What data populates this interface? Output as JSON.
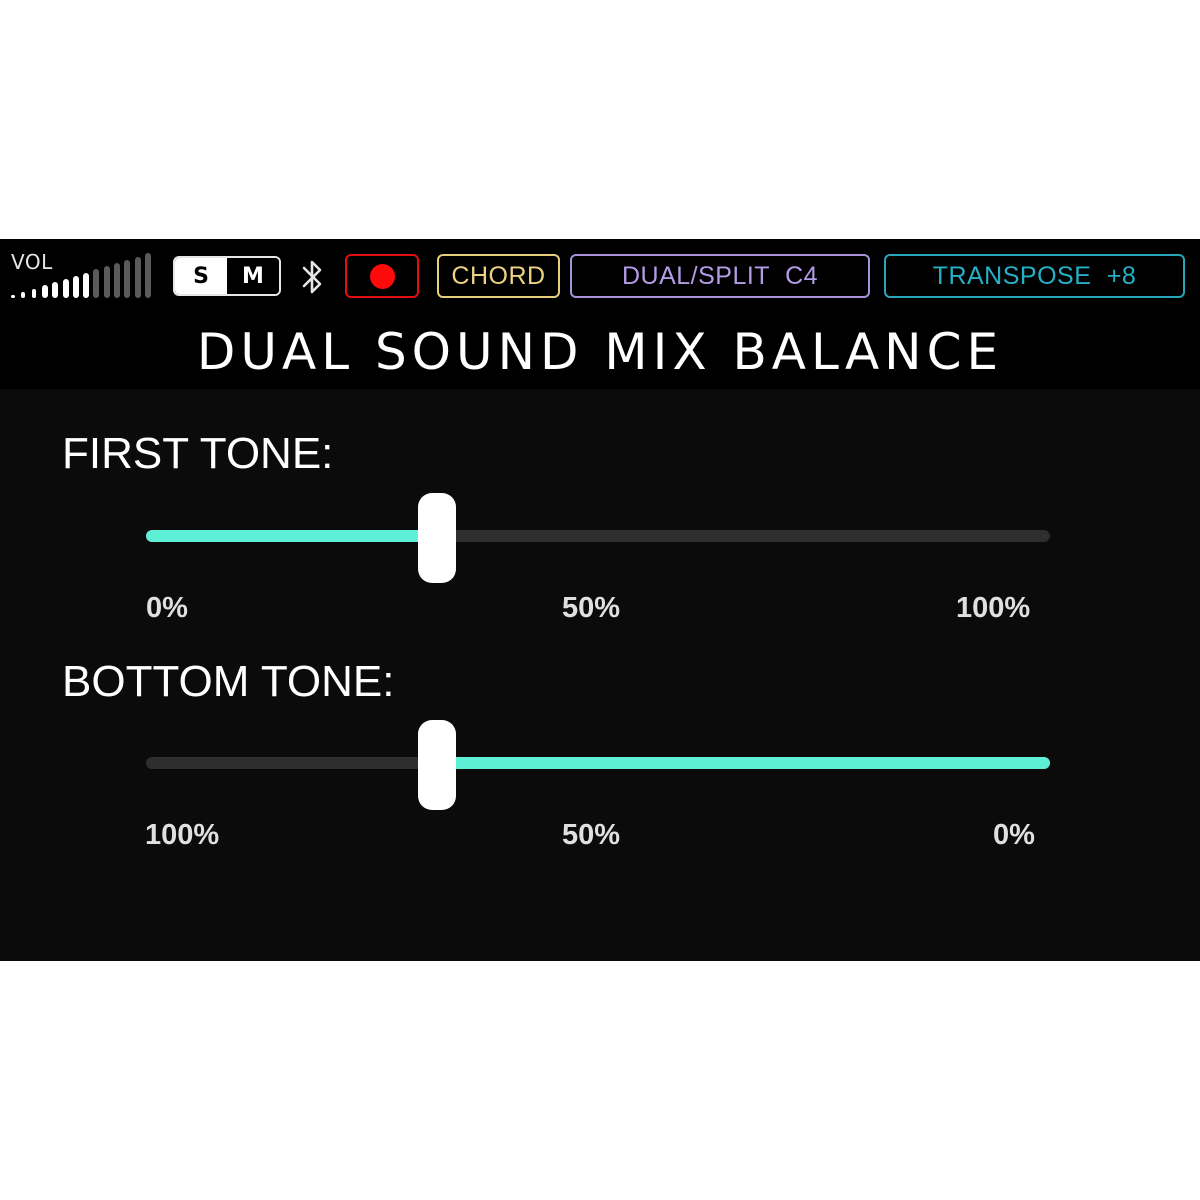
{
  "status_bar": {
    "vol_label": "VOL",
    "volume_level_fraction": 0.57,
    "solo_label": "S",
    "mute_label": "M",
    "chord_label": "CHORD",
    "dual_split_label": "DUAL/SPLIT C4",
    "transpose_label": "TRANSPOSE +8",
    "icons": [
      "bluetooth-icon",
      "record-icon"
    ],
    "colors": {
      "record": "#ff0a0a",
      "chord": "#ecd282",
      "dual_split": "#b29ce6",
      "transpose": "#26b0c6"
    }
  },
  "page": {
    "title": "DUAL SOUND MIX BALANCE"
  },
  "first_tone": {
    "label": "FIRST TONE:",
    "value_fraction": 0.32,
    "ticks": [
      "0%",
      "50%",
      "100%"
    ]
  },
  "bottom_tone": {
    "label": "BOTTOM TONE:",
    "value_fraction": 0.32,
    "ticks": [
      "100%",
      "50%",
      "0%"
    ]
  },
  "accent_color": "#5ef0d6"
}
